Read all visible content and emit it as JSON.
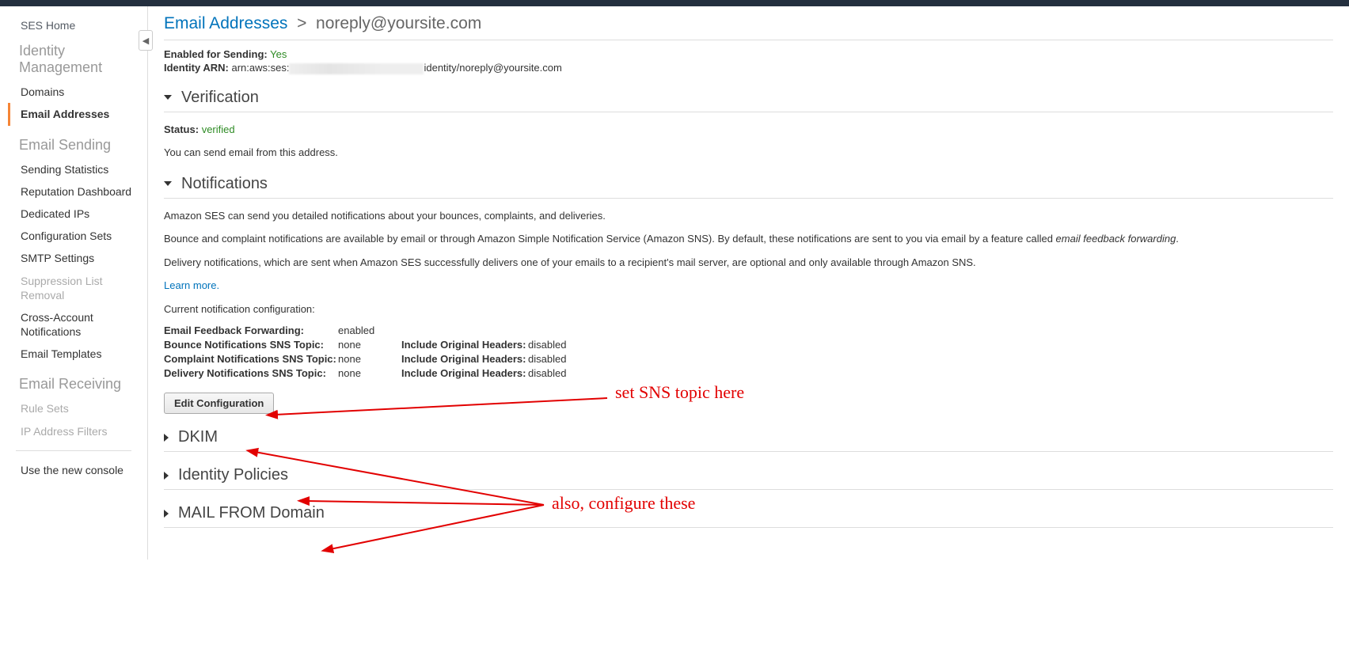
{
  "sidebar": {
    "home": "SES Home",
    "group_identity": "Identity Management",
    "domains": "Domains",
    "email_addresses": "Email Addresses",
    "group_sending": "Email Sending",
    "sending_stats": "Sending Statistics",
    "reputation": "Reputation Dashboard",
    "dedicated_ips": "Dedicated IPs",
    "config_sets": "Configuration Sets",
    "smtp": "SMTP Settings",
    "suppression": "Suppression List Removal",
    "cross_account": "Cross-Account Notifications",
    "templates": "Email Templates",
    "group_receiving": "Email Receiving",
    "rule_sets": "Rule Sets",
    "ip_filters": "IP Address Filters",
    "new_console": "Use the new console"
  },
  "breadcrumb": {
    "parent": "Email Addresses",
    "sep": ">",
    "current": "noreply@yoursite.com"
  },
  "summary": {
    "enabled_label": "Enabled for Sending:",
    "enabled_value": "Yes",
    "arn_label": "Identity ARN:",
    "arn_prefix": "arn:aws:ses:",
    "arn_suffix": "identity/noreply@yoursite.com"
  },
  "verification": {
    "title": "Verification",
    "status_label": "Status:",
    "status_value": "verified",
    "body": "You can send email from this address."
  },
  "notifications": {
    "title": "Notifications",
    "p1": "Amazon SES can send you detailed notifications about your bounces, complaints, and deliveries.",
    "p2a": "Bounce and complaint notifications are available by email or through Amazon Simple Notification Service (Amazon SNS). By default, these notifications are sent to you via email by a feature called ",
    "p2em": "email feedback forwarding",
    "p2b": ".",
    "p3": "Delivery notifications, which are sent when Amazon SES successfully delivers one of your emails to a recipient's mail server, are optional and only available through Amazon SNS.",
    "learn_more": "Learn more.",
    "current_config": "Current notification configuration:",
    "rows": {
      "eff_k": "Email Feedback Forwarding:",
      "eff_v": "enabled",
      "bounce_k": "Bounce Notifications SNS Topic:",
      "bounce_v": "none",
      "complaint_k": "Complaint Notifications SNS Topic:",
      "complaint_v": "none",
      "delivery_k": "Delivery Notifications SNS Topic:",
      "delivery_v": "none",
      "ioh_k": "Include Original Headers:",
      "ioh_v": "disabled"
    },
    "edit_btn": "Edit Configuration"
  },
  "sections": {
    "dkim": "DKIM",
    "policies": "Identity Policies",
    "mailfrom": "MAIL FROM Domain"
  },
  "annotations": {
    "sns": "set SNS topic here",
    "configure": "also, configure these"
  }
}
